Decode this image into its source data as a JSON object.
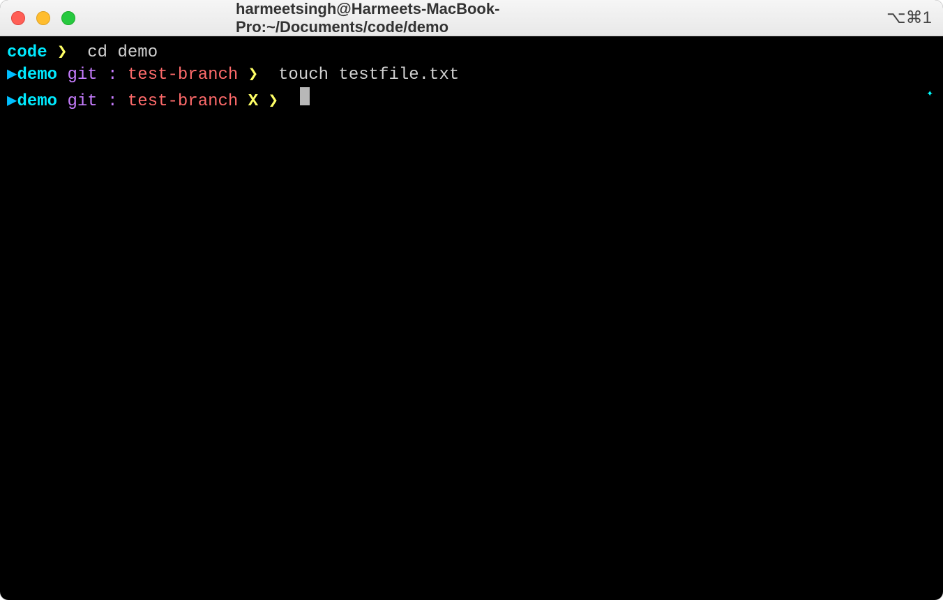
{
  "titlebar": {
    "title": "harmeetsingh@Harmeets-MacBook-Pro:~/Documents/code/demo",
    "shortcut": "⌥⌘1"
  },
  "lines": [
    {
      "segments": [
        {
          "text": "code",
          "class": "dir"
        },
        {
          "text": " ",
          "class": ""
        },
        {
          "text": "❯",
          "class": "chevron"
        },
        {
          "text": "  ",
          "class": ""
        },
        {
          "text": "cd demo",
          "class": "cmd"
        }
      ]
    },
    {
      "segments": [
        {
          "text": "▶",
          "class": "arrow"
        },
        {
          "text": "demo",
          "class": "dir"
        },
        {
          "text": " ",
          "class": ""
        },
        {
          "text": "git",
          "class": "git-label"
        },
        {
          "text": " ",
          "class": ""
        },
        {
          "text": ":",
          "class": "colon"
        },
        {
          "text": " ",
          "class": ""
        },
        {
          "text": "test-branch",
          "class": "branch"
        },
        {
          "text": " ",
          "class": ""
        },
        {
          "text": "❯",
          "class": "chevron"
        },
        {
          "text": "  ",
          "class": ""
        },
        {
          "text": "touch testfile.txt",
          "class": "cmd"
        }
      ]
    },
    {
      "segments": [
        {
          "text": "▶",
          "class": "arrow"
        },
        {
          "text": "demo",
          "class": "dir"
        },
        {
          "text": " ",
          "class": ""
        },
        {
          "text": "git",
          "class": "git-label"
        },
        {
          "text": " ",
          "class": ""
        },
        {
          "text": ":",
          "class": "colon"
        },
        {
          "text": " ",
          "class": ""
        },
        {
          "text": "test-branch",
          "class": "branch"
        },
        {
          "text": " ",
          "class": ""
        },
        {
          "text": "X",
          "class": "dirty"
        },
        {
          "text": " ",
          "class": ""
        },
        {
          "text": "❯",
          "class": "chevron"
        },
        {
          "text": "  ",
          "class": ""
        }
      ],
      "cursor": true
    }
  ],
  "star": "✦"
}
